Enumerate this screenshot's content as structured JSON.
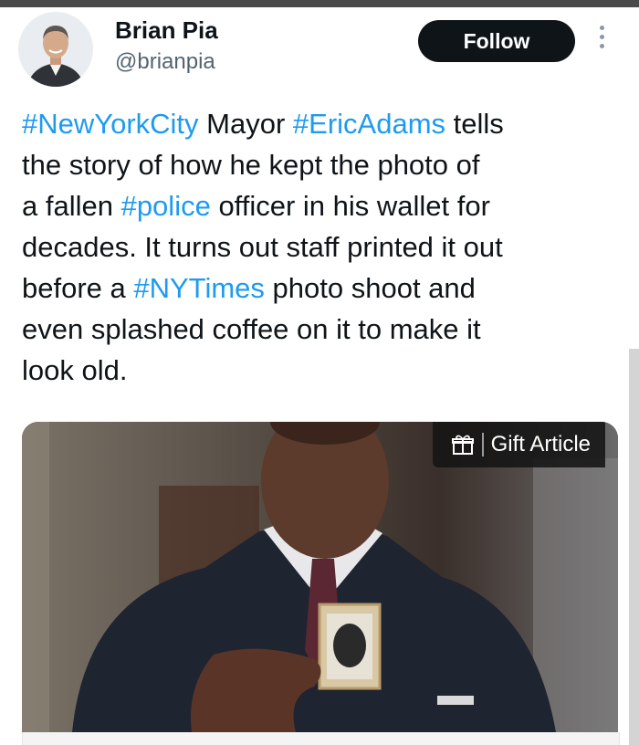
{
  "author": {
    "name": "Brian Pia",
    "handle": "@brianpia",
    "avatar_icon": "profile-photo"
  },
  "actions": {
    "follow_label": "Follow",
    "more_icon": "vertical-ellipsis-icon"
  },
  "tweet": {
    "lines": [
      [
        {
          "t": "#NewYorkCity",
          "tag": true
        },
        {
          "t": " Mayor ",
          "tag": false
        },
        {
          "t": "#EricAdams",
          "tag": true
        },
        {
          "t": " tells",
          "tag": false
        }
      ],
      [
        {
          "t": "the story of how he kept the photo of",
          "tag": false
        }
      ],
      [
        {
          "t": "a fallen ",
          "tag": false
        },
        {
          "t": "#police",
          "tag": true
        },
        {
          "t": " officer in his wallet for",
          "tag": false
        }
      ],
      [
        {
          "t": "decades. It turns out staff printed it out",
          "tag": false
        }
      ],
      [
        {
          "t": "before a ",
          "tag": false
        },
        {
          "t": "#NYTimes",
          "tag": true
        },
        {
          "t": " photo shoot and",
          "tag": false
        }
      ],
      [
        {
          "t": "even splashed coffee on it to make it",
          "tag": false
        }
      ],
      [
        {
          "t": "look old.",
          "tag": false
        }
      ]
    ]
  },
  "media": {
    "gift_label": "Gift Article",
    "gift_icon": "gift-icon"
  },
  "colors": {
    "hashtag": "#1d9bf0",
    "follow_bg": "#0f1419",
    "text": "#0f1419",
    "secondary": "#536471"
  }
}
